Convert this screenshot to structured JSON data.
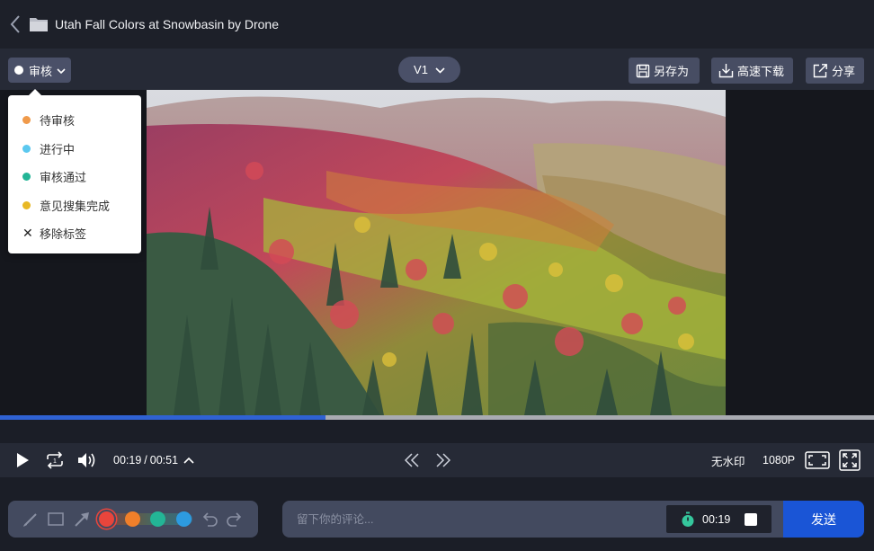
{
  "window": {
    "title": "Utah Fall Colors at Snowbasin by Drone"
  },
  "toolbar": {
    "review_label": "审核",
    "version_label": "V1",
    "save_as_label": "另存为",
    "download_label": "高速下载",
    "share_label": "分享"
  },
  "review_menu": {
    "items": [
      {
        "label": "待审核",
        "color": "#f09a4a"
      },
      {
        "label": "进行中",
        "color": "#5bc8ef"
      },
      {
        "label": "审核通过",
        "color": "#23b596"
      },
      {
        "label": "意见搜集完成",
        "color": "#e8b824"
      },
      {
        "label": "移除标签"
      }
    ]
  },
  "playback": {
    "current_time": "00:19",
    "total_time": "00:51",
    "time_separator": "/",
    "progress_fraction": 0.3725,
    "watermark_label": "无水印",
    "resolution_label": "1080P"
  },
  "annotation": {
    "colors": [
      "#e8453c",
      "#f07f2a",
      "#23b596",
      "#2d9be0"
    ],
    "selected_color": "#e8453c"
  },
  "comment": {
    "placeholder": "留下你的评论...",
    "timestamp": "00:19",
    "send_label": "发送"
  },
  "colors": {
    "accent": "#1a55d6",
    "progress": "#2f62d3",
    "button_bg": "#474d63"
  }
}
